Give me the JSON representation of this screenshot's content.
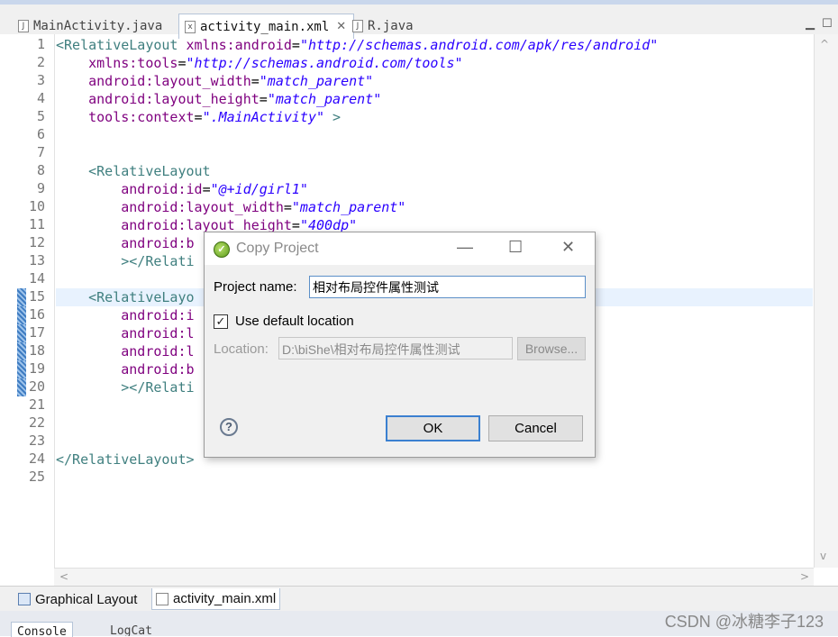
{
  "tabs": [
    {
      "label": "MainActivity.java",
      "icon": "java-file-icon"
    },
    {
      "label": "activity_main.xml",
      "icon": "xml-file-icon",
      "active": true
    },
    {
      "label": "R.java",
      "icon": "java-file-icon"
    }
  ],
  "tab_close": "✕",
  "line_numbers": [
    "1",
    "2",
    "3",
    "4",
    "5",
    "6",
    "7",
    "8",
    "9",
    "10",
    "11",
    "12",
    "13",
    "14",
    "15",
    "16",
    "17",
    "18",
    "19",
    "20",
    "21",
    "22",
    "23",
    "24",
    "25"
  ],
  "code": {
    "l1": {
      "tag": "<RelativeLayout",
      "attr": " xmlns:android",
      "eq": "=",
      "val": "\"http://schemas.android.com/apk/res/android\""
    },
    "l2": {
      "attr": "    xmlns:tools",
      "eq": "=",
      "val": "\"http://schemas.android.com/tools\""
    },
    "l3": {
      "attr": "    android:layout_width",
      "eq": "=",
      "val": "\"match_parent\""
    },
    "l4": {
      "attr": "    android:layout_height",
      "eq": "=",
      "val": "\"match_parent\""
    },
    "l5": {
      "attr": "    tools:context",
      "eq": "=",
      "val": "\".MainActivity\"",
      "end": " >"
    },
    "l8": {
      "tag": "    <RelativeLayout"
    },
    "l9": {
      "attr": "        android:id",
      "eq": "=",
      "val": "\"@+id/girl1\""
    },
    "l10": {
      "attr": "        android:layout_width",
      "eq": "=",
      "val": "\"match_parent\""
    },
    "l11": {
      "attr": "        android:layout_height",
      "eq": "=",
      "val": "\"400dp\""
    },
    "l12": {
      "attr": "        android:b"
    },
    "l13": {
      "tag": "        ></Relati"
    },
    "l15": {
      "tag": "    <RelativeLayo"
    },
    "l16": {
      "attr": "        android:i"
    },
    "l17": {
      "attr": "        android:l"
    },
    "l18": {
      "attr": "        android:l"
    },
    "l19": {
      "attr": "        android:b"
    },
    "l20": {
      "tag": "        ><",
      "tag2": "/Relati"
    },
    "l24": {
      "tag": "</RelativeLayout>"
    }
  },
  "bottom_tabs": [
    {
      "label": "Graphical Layout"
    },
    {
      "label": "activity_main.xml"
    }
  ],
  "console": {
    "console_label": "Console",
    "logcat_label": "LogCat"
  },
  "watermark": "CSDN @冰糖李子123",
  "dialog": {
    "title": "Copy Project",
    "project_name_label": "Project name:",
    "project_name_value": "相对布局控件属性测试",
    "use_default_label": "Use default location",
    "use_default_checked": true,
    "location_label": "Location:",
    "location_value": "D:\\biShe\\相对布局控件属性测试",
    "browse_label": "Browse...",
    "help_symbol": "?",
    "ok_label": "OK",
    "cancel_label": "Cancel",
    "minimize": "—",
    "maximize": "☐",
    "close": "✕"
  }
}
